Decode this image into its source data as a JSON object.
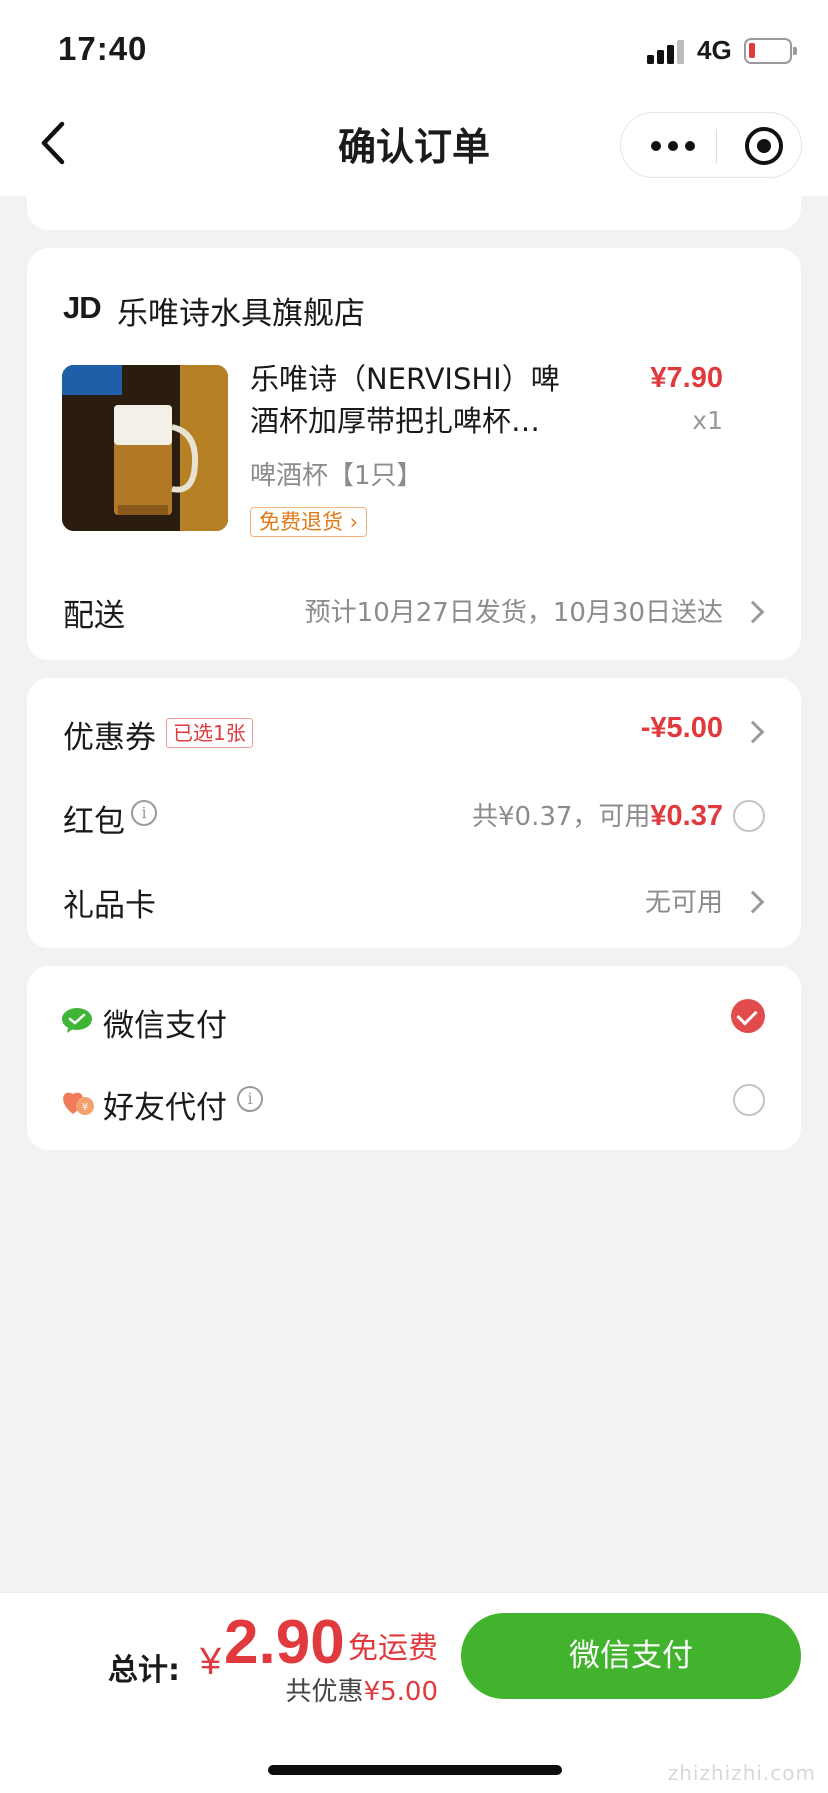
{
  "status_bar": {
    "time": "17:40",
    "network": "4G"
  },
  "nav": {
    "title": "确认订单"
  },
  "store": {
    "logo": "JD",
    "name": "乐唯诗水具旗舰店",
    "product": {
      "title": "乐唯诗（NERVISHI）啤酒杯加厚带把扎啤杯…",
      "price": "¥7.90",
      "quantity": "x1",
      "spec": "啤酒杯【1只】",
      "return_tag": "免费退货 ›"
    },
    "delivery": {
      "label": "配送",
      "value": "预计10月27日发货，10月30日送达"
    }
  },
  "discounts": {
    "coupon": {
      "label": "优惠券",
      "tag": "已选1张",
      "value": "-¥5.00"
    },
    "red_packet": {
      "label": "红包",
      "total": "共¥0.37，可用",
      "available": "¥0.37"
    },
    "gift_card": {
      "label": "礼品卡",
      "value": "无可用"
    }
  },
  "payment": {
    "wechat": {
      "label": "微信支付",
      "selected": true
    },
    "friend": {
      "label": "好友代付",
      "selected": false
    }
  },
  "footer": {
    "total_label": "总计:",
    "currency": "¥",
    "total_amount": "2.90",
    "free_shipping": "免运费",
    "saved_prefix": "共优惠",
    "saved_amount": "¥5.00",
    "pay_button": "微信支付"
  },
  "colors": {
    "accent_red": "#e0393e",
    "wechat_green": "#42b32c"
  },
  "watermark": "zhizhizhi.com"
}
